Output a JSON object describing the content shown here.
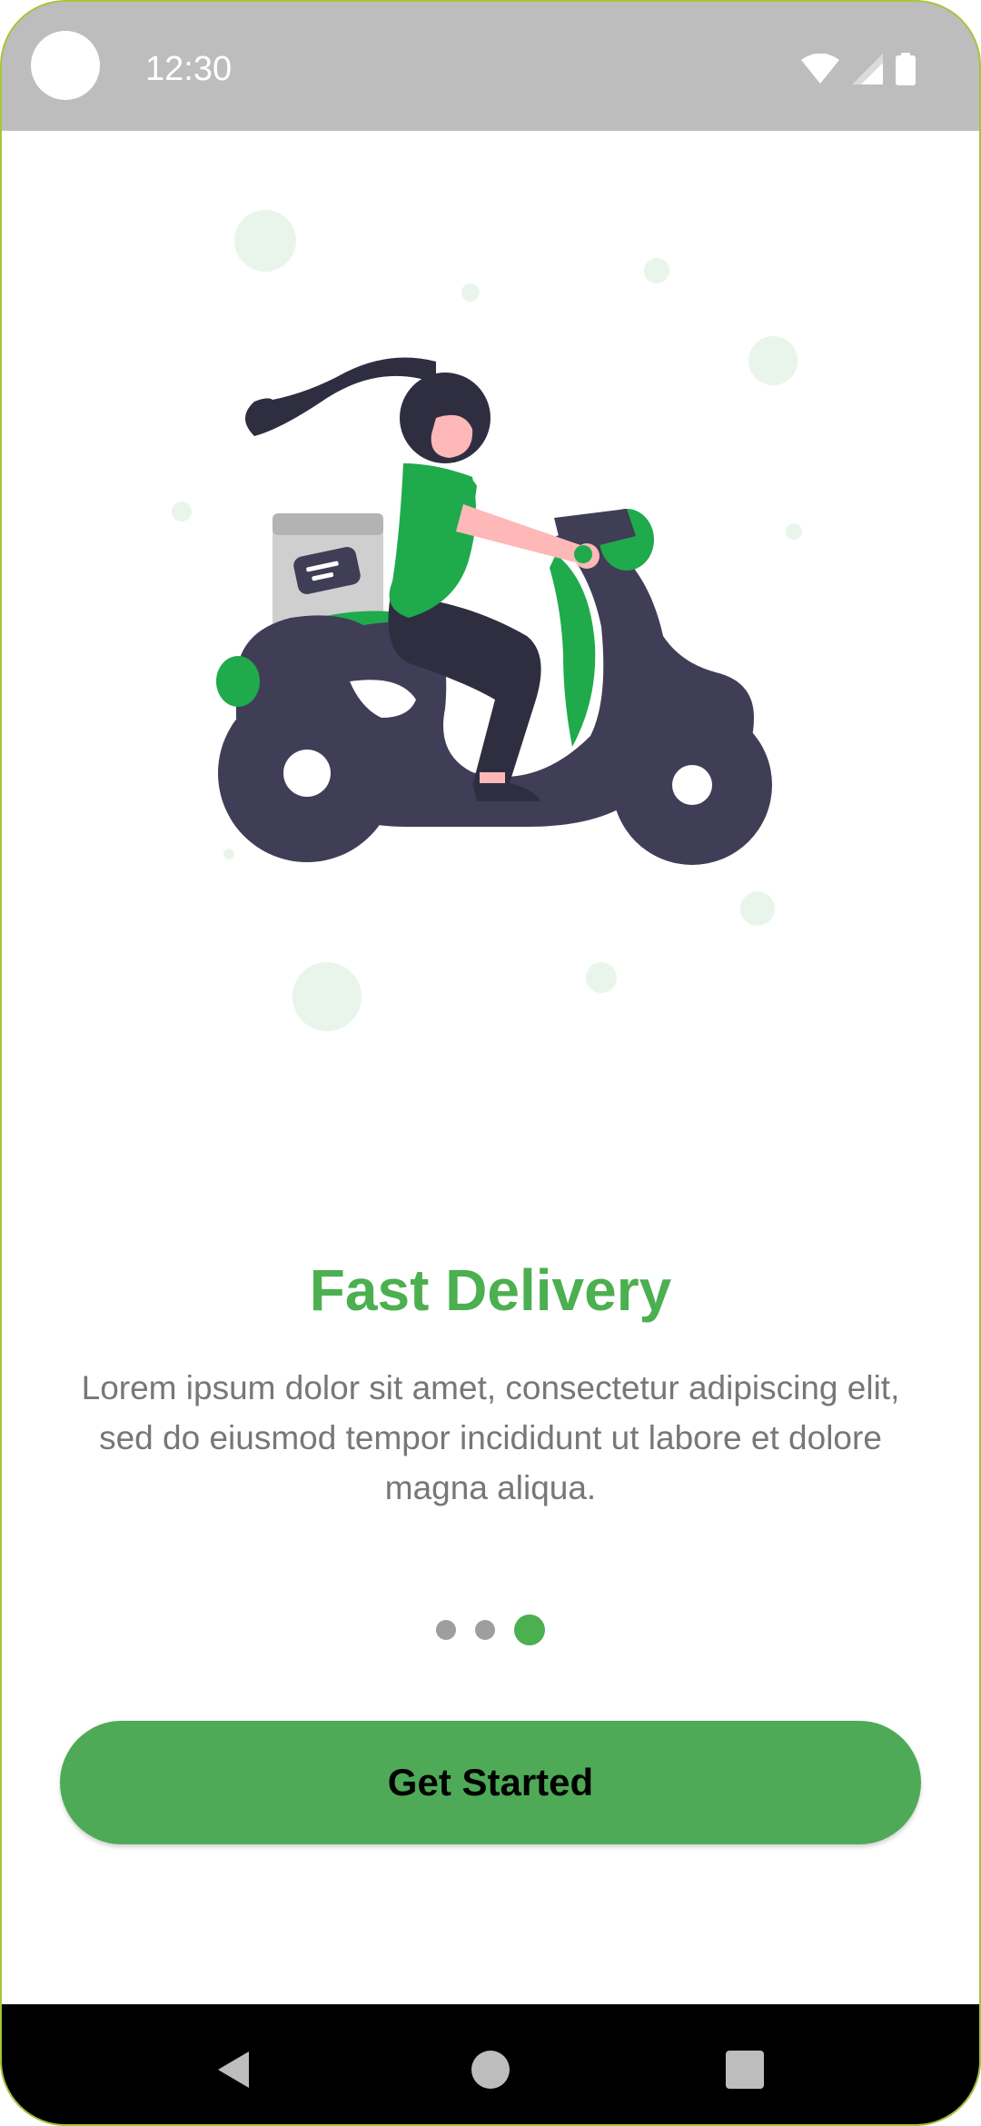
{
  "status_bar": {
    "time": "12:30",
    "icons": [
      "wifi-icon",
      "signal-icon",
      "battery-icon"
    ]
  },
  "onboarding": {
    "illustration": "woman-riding-delivery-scooter",
    "title": "Fast Delivery",
    "description": "Lorem ipsum dolor sit amet, consectetur adipiscing elit, sed do eiusmod tempor incididunt ut labore et dolore magna aliqua.",
    "page_count": 3,
    "current_page": 3,
    "button_label": "Get Started"
  },
  "nav_bar": {
    "buttons": [
      "back-icon",
      "home-icon",
      "recents-icon"
    ]
  },
  "colors": {
    "accent": "#4caf50",
    "button": "#4eaa56",
    "status_bar": "#bdbdbd",
    "text_secondary": "#777777",
    "scooter": "#403d56",
    "dot_inactive": "#9e9e9e"
  }
}
